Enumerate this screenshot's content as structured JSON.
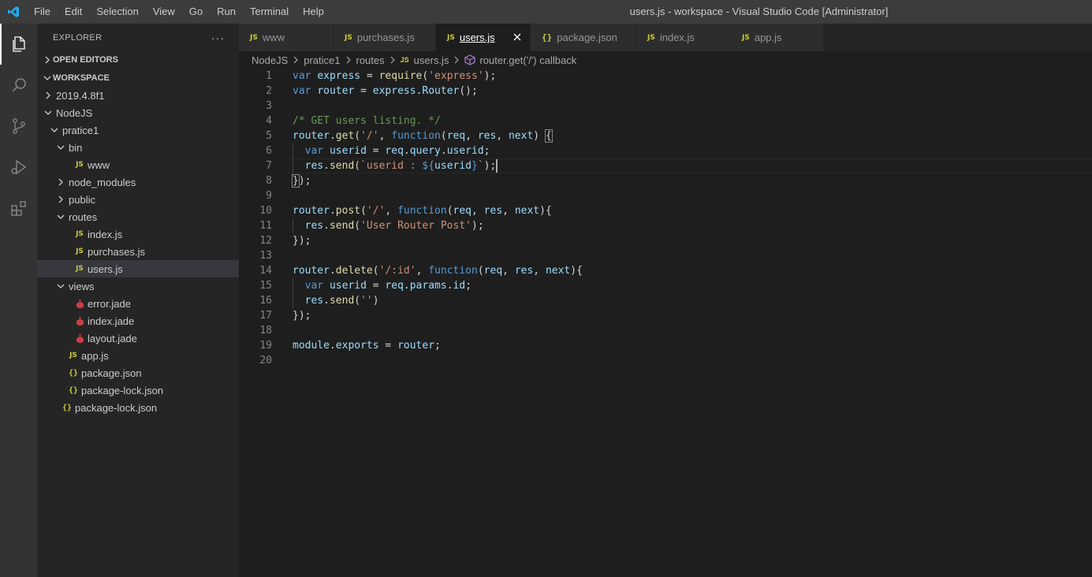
{
  "titlebar": {
    "menu": [
      "File",
      "Edit",
      "Selection",
      "View",
      "Go",
      "Run",
      "Terminal",
      "Help"
    ],
    "window_title": "users.js - workspace - Visual Studio Code [Administrator]"
  },
  "sidebar": {
    "title": "EXPLORER",
    "more": "···",
    "open_editors": "OPEN EDITORS",
    "workspace": "WORKSPACE",
    "tree": [
      {
        "label": "2019.4.8f1",
        "type": "folder",
        "open": false,
        "depth": 0
      },
      {
        "label": "NodeJS",
        "type": "folder",
        "open": true,
        "depth": 0
      },
      {
        "label": "pratice1",
        "type": "folder",
        "open": true,
        "depth": 1
      },
      {
        "label": "bin",
        "type": "folder",
        "open": true,
        "depth": 2
      },
      {
        "label": "www",
        "type": "js",
        "depth": 3
      },
      {
        "label": "node_modules",
        "type": "folder",
        "open": false,
        "depth": 2
      },
      {
        "label": "public",
        "type": "folder",
        "open": false,
        "depth": 2
      },
      {
        "label": "routes",
        "type": "folder",
        "open": true,
        "depth": 2
      },
      {
        "label": "index.js",
        "type": "js",
        "depth": 3
      },
      {
        "label": "purchases.js",
        "type": "js",
        "depth": 3
      },
      {
        "label": "users.js",
        "type": "js",
        "depth": 3,
        "selected": true
      },
      {
        "label": "views",
        "type": "folder",
        "open": true,
        "depth": 2
      },
      {
        "label": "error.jade",
        "type": "jade",
        "depth": 3
      },
      {
        "label": "index.jade",
        "type": "jade",
        "depth": 3
      },
      {
        "label": "layout.jade",
        "type": "jade",
        "depth": 3
      },
      {
        "label": "app.js",
        "type": "js",
        "depth": 2
      },
      {
        "label": "package.json",
        "type": "json",
        "depth": 2
      },
      {
        "label": "package-lock.json",
        "type": "json",
        "depth": 2
      },
      {
        "label": "package-lock.json",
        "type": "json",
        "depth": 1
      }
    ]
  },
  "tabs": [
    {
      "label": "www",
      "icon": "JS",
      "width": 120
    },
    {
      "label": "purchases.js",
      "icon": "JS",
      "width": 130
    },
    {
      "label": "users.js",
      "icon": "JS",
      "width": 120,
      "active": true
    },
    {
      "label": "package.json",
      "icon": "{}",
      "width": 134
    },
    {
      "label": "index.js",
      "icon": "JS",
      "width": 120
    },
    {
      "label": "app.js",
      "icon": "JS",
      "width": 118
    }
  ],
  "icons": {
    "js": "JS",
    "json": "{}",
    "close": "×"
  },
  "breadcrumbs": [
    "NodeJS",
    "pratice1",
    "routes",
    "users.js",
    "router.get('/') callback"
  ],
  "code_lines": [
    [
      [
        "kw",
        "var"
      ],
      [
        "pun",
        " "
      ],
      [
        "var",
        "express"
      ],
      [
        "pun",
        " = "
      ],
      [
        "fn",
        "require"
      ],
      [
        "pun",
        "("
      ],
      [
        "str",
        "'express'"
      ],
      [
        "pun",
        ");"
      ]
    ],
    [
      [
        "kw",
        "var"
      ],
      [
        "pun",
        " "
      ],
      [
        "var",
        "router"
      ],
      [
        "pun",
        " = "
      ],
      [
        "var",
        "express"
      ],
      [
        "pun",
        "."
      ],
      [
        "var",
        "Router"
      ],
      [
        "pun",
        "();"
      ]
    ],
    [],
    [
      [
        "cmt",
        "/* GET users listing. */"
      ]
    ],
    [
      [
        "var",
        "router"
      ],
      [
        "pun",
        "."
      ],
      [
        "fn",
        "get"
      ],
      [
        "pun",
        "("
      ],
      [
        "str",
        "'/'"
      ],
      [
        "pun",
        ", "
      ],
      [
        "kw",
        "function"
      ],
      [
        "pun",
        "("
      ],
      [
        "var",
        "req"
      ],
      [
        "pun",
        ", "
      ],
      [
        "var",
        "res"
      ],
      [
        "pun",
        ", "
      ],
      [
        "var",
        "next"
      ],
      [
        "pun",
        ") {"
      ]
    ],
    [
      [
        "pun",
        "  "
      ],
      [
        "kw",
        "var"
      ],
      [
        "pun",
        " "
      ],
      [
        "var",
        "userid"
      ],
      [
        "pun",
        " = "
      ],
      [
        "var",
        "req"
      ],
      [
        "pun",
        "."
      ],
      [
        "var",
        "query"
      ],
      [
        "pun",
        "."
      ],
      [
        "var",
        "userid"
      ],
      [
        "pun",
        ";"
      ]
    ],
    [
      [
        "pun",
        "  "
      ],
      [
        "var",
        "res"
      ],
      [
        "pun",
        "."
      ],
      [
        "fn",
        "send"
      ],
      [
        "pun",
        "("
      ],
      [
        "str",
        "`userid : "
      ],
      [
        "kw",
        "${"
      ],
      [
        "var",
        "userid"
      ],
      [
        "kw",
        "}"
      ],
      [
        "str",
        "`"
      ],
      [
        "pun",
        ");"
      ]
    ],
    [
      [
        "pun",
        "});"
      ]
    ],
    [],
    [
      [
        "var",
        "router"
      ],
      [
        "pun",
        "."
      ],
      [
        "fn",
        "post"
      ],
      [
        "pun",
        "("
      ],
      [
        "str",
        "'/'"
      ],
      [
        "pun",
        ", "
      ],
      [
        "kw",
        "function"
      ],
      [
        "pun",
        "("
      ],
      [
        "var",
        "req"
      ],
      [
        "pun",
        ", "
      ],
      [
        "var",
        "res"
      ],
      [
        "pun",
        ", "
      ],
      [
        "var",
        "next"
      ],
      [
        "pun",
        "){"
      ]
    ],
    [
      [
        "pun",
        "  "
      ],
      [
        "var",
        "res"
      ],
      [
        "pun",
        "."
      ],
      [
        "fn",
        "send"
      ],
      [
        "pun",
        "("
      ],
      [
        "str",
        "'User Router Post'"
      ],
      [
        "pun",
        ");"
      ]
    ],
    [
      [
        "pun",
        "});"
      ]
    ],
    [],
    [
      [
        "var",
        "router"
      ],
      [
        "pun",
        "."
      ],
      [
        "fn",
        "delete"
      ],
      [
        "pun",
        "("
      ],
      [
        "str",
        "'/:id'"
      ],
      [
        "pun",
        ", "
      ],
      [
        "kw",
        "function"
      ],
      [
        "pun",
        "("
      ],
      [
        "var",
        "req"
      ],
      [
        "pun",
        ", "
      ],
      [
        "var",
        "res"
      ],
      [
        "pun",
        ", "
      ],
      [
        "var",
        "next"
      ],
      [
        "pun",
        "){"
      ]
    ],
    [
      [
        "pun",
        "  "
      ],
      [
        "kw",
        "var"
      ],
      [
        "pun",
        " "
      ],
      [
        "var",
        "userid"
      ],
      [
        "pun",
        " = "
      ],
      [
        "var",
        "req"
      ],
      [
        "pun",
        "."
      ],
      [
        "var",
        "params"
      ],
      [
        "pun",
        "."
      ],
      [
        "var",
        "id"
      ],
      [
        "pun",
        ";"
      ]
    ],
    [
      [
        "pun",
        "  "
      ],
      [
        "var",
        "res"
      ],
      [
        "pun",
        "."
      ],
      [
        "fn",
        "send"
      ],
      [
        "pun",
        "("
      ],
      [
        "str",
        "''"
      ],
      [
        "pun",
        ")"
      ]
    ],
    [
      [
        "pun",
        "});"
      ]
    ],
    [],
    [
      [
        "var",
        "module"
      ],
      [
        "pun",
        "."
      ],
      [
        "var",
        "exports"
      ],
      [
        "pun",
        " = "
      ],
      [
        "var",
        "router"
      ],
      [
        "pun",
        ";"
      ]
    ],
    []
  ],
  "active_line": 7
}
